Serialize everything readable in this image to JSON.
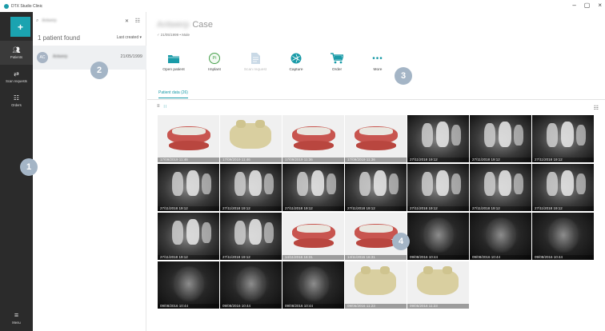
{
  "app": {
    "title": "DTX Studio Clinic"
  },
  "window": {
    "minimize": "–",
    "maximize": "▢",
    "close": "×"
  },
  "nav": {
    "add_label": "+",
    "items": [
      {
        "label": "Patients",
        "icon": "patients-icon"
      },
      {
        "label": "Scan requests",
        "icon": "scan-requests-icon"
      },
      {
        "label": "Orders",
        "icon": "orders-icon"
      }
    ],
    "menu_label": "Menu"
  },
  "patient_list": {
    "search_placeholder": "",
    "search_value": "Antwerp",
    "found_text": "1 patient found",
    "sort_label": "Last created ▾",
    "patients": [
      {
        "initials": "AC",
        "name": "Antwerp",
        "date": "21/05/1999"
      }
    ]
  },
  "case": {
    "title_blurred": "Antwerp",
    "title": "Case",
    "subtitle": "♂ 21/05/1999 • Male"
  },
  "toolbar": [
    {
      "label": "Open patient",
      "icon": "folder-icon",
      "enabled": true
    },
    {
      "label": "Implant",
      "icon": "implant-icon",
      "enabled": true
    },
    {
      "label": "Scan request",
      "icon": "document-icon",
      "enabled": false
    },
    {
      "label": "Capture",
      "icon": "aperture-icon",
      "enabled": true
    },
    {
      "label": "Order",
      "icon": "cart-icon",
      "enabled": true
    },
    {
      "label": "More",
      "icon": "more-icon",
      "enabled": true
    }
  ],
  "tabs": [
    {
      "label": "Patient data (26)"
    }
  ],
  "thumbnails": [
    {
      "kind": "model",
      "date": "17/09/2019 11:46"
    },
    {
      "kind": "stone",
      "date": "17/09/2019 11:46"
    },
    {
      "kind": "model",
      "date": "17/09/2019 11:36"
    },
    {
      "kind": "model",
      "date": "17/09/2019 11:36"
    },
    {
      "kind": "xray",
      "date": "27/11/2018 19:12"
    },
    {
      "kind": "xray",
      "date": "27/11/2018 19:12"
    },
    {
      "kind": "xray",
      "date": "27/11/2018 19:12"
    },
    {
      "kind": "xray",
      "date": "27/11/2018 19:12"
    },
    {
      "kind": "xray",
      "date": "27/11/2018 19:12"
    },
    {
      "kind": "xray",
      "date": "27/11/2018 19:12"
    },
    {
      "kind": "xray",
      "date": "27/11/2018 19:12"
    },
    {
      "kind": "xray",
      "date": "27/11/2018 19:12"
    },
    {
      "kind": "xray",
      "date": "27/11/2018 19:12"
    },
    {
      "kind": "xray",
      "date": "27/11/2018 19:12"
    },
    {
      "kind": "xray",
      "date": "27/11/2018 19:12"
    },
    {
      "kind": "xray",
      "date": "27/11/2018 19:12"
    },
    {
      "kind": "model",
      "date": "14/11/2016 16:31"
    },
    {
      "kind": "model",
      "date": "14/11/2016 16:31"
    },
    {
      "kind": "ct",
      "date": "09/08/2016 10:44"
    },
    {
      "kind": "ct",
      "date": "09/08/2016 10:44"
    },
    {
      "kind": "ct",
      "date": "09/08/2016 10:44"
    },
    {
      "kind": "ct",
      "date": "09/08/2016 10:44"
    },
    {
      "kind": "ct",
      "date": "09/08/2016 10:44"
    },
    {
      "kind": "ct",
      "date": "09/08/2016 10:44"
    },
    {
      "kind": "stone",
      "date": "09/05/2016 11:23"
    },
    {
      "kind": "stone",
      "date": "09/05/2016 11:23"
    }
  ],
  "callouts": [
    "1",
    "2",
    "3",
    "4"
  ]
}
